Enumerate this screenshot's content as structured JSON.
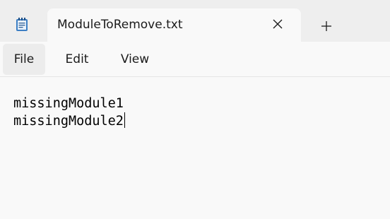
{
  "tab": {
    "title": "ModuleToRemove.txt",
    "app_icon": "notepad-icon",
    "close_icon": "close-icon",
    "new_tab_icon": "plus-icon"
  },
  "menu": {
    "file": "File",
    "edit": "Edit",
    "view": "View"
  },
  "editor": {
    "lines": [
      "missingModule1",
      "missingModule2"
    ]
  },
  "colors": {
    "tabstrip_bg": "#eeeeee",
    "content_bg": "#f9f9f9",
    "icon_blue": "#3c7fc4"
  }
}
